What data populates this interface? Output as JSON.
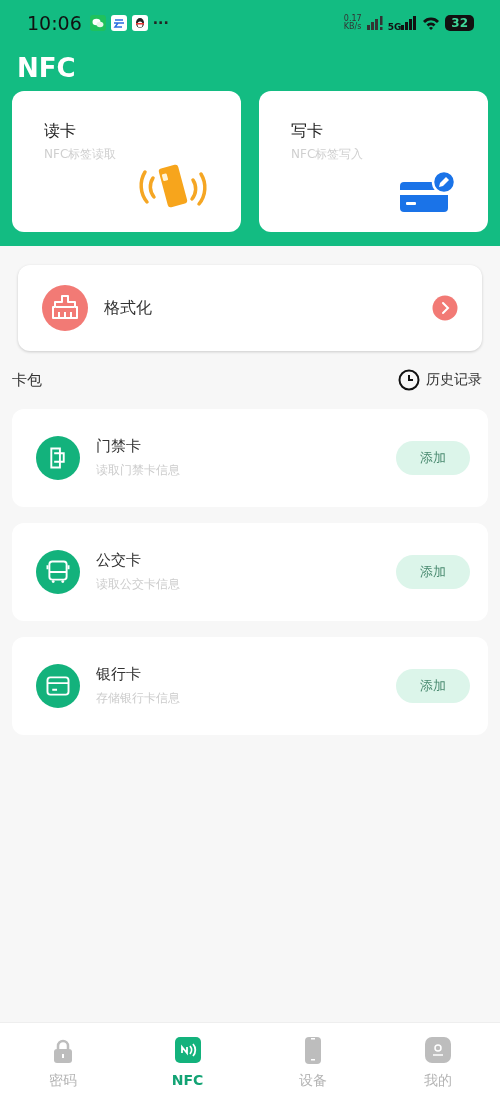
{
  "status_bar": {
    "time": "10:06",
    "more": "···",
    "speed_value": "0.17",
    "speed_unit": "KB/s",
    "network": "5G",
    "battery": "32"
  },
  "header": {
    "title": "NFC"
  },
  "actions": [
    {
      "kind": "read",
      "title": "读卡",
      "subtitle": "NFC标签读取"
    },
    {
      "kind": "write",
      "title": "写卡",
      "subtitle": "NFC标签写入"
    }
  ],
  "format": {
    "label": "格式化"
  },
  "wallet": {
    "title": "卡包",
    "history": "历史记录"
  },
  "cards": [
    {
      "kind": "door",
      "name": "门禁卡",
      "desc": "读取门禁卡信息",
      "button": "添加"
    },
    {
      "kind": "bus",
      "name": "公交卡",
      "desc": "读取公交卡信息",
      "button": "添加"
    },
    {
      "kind": "bank",
      "name": "银行卡",
      "desc": "存储银行卡信息",
      "button": "添加"
    }
  ],
  "tabs": [
    {
      "kind": "lock",
      "label": "密码",
      "selected": false
    },
    {
      "kind": "nfc",
      "label": "NFC",
      "selected": true
    },
    {
      "kind": "phone",
      "label": "设备",
      "selected": false
    },
    {
      "kind": "profile",
      "label": "我的",
      "selected": false
    }
  ]
}
